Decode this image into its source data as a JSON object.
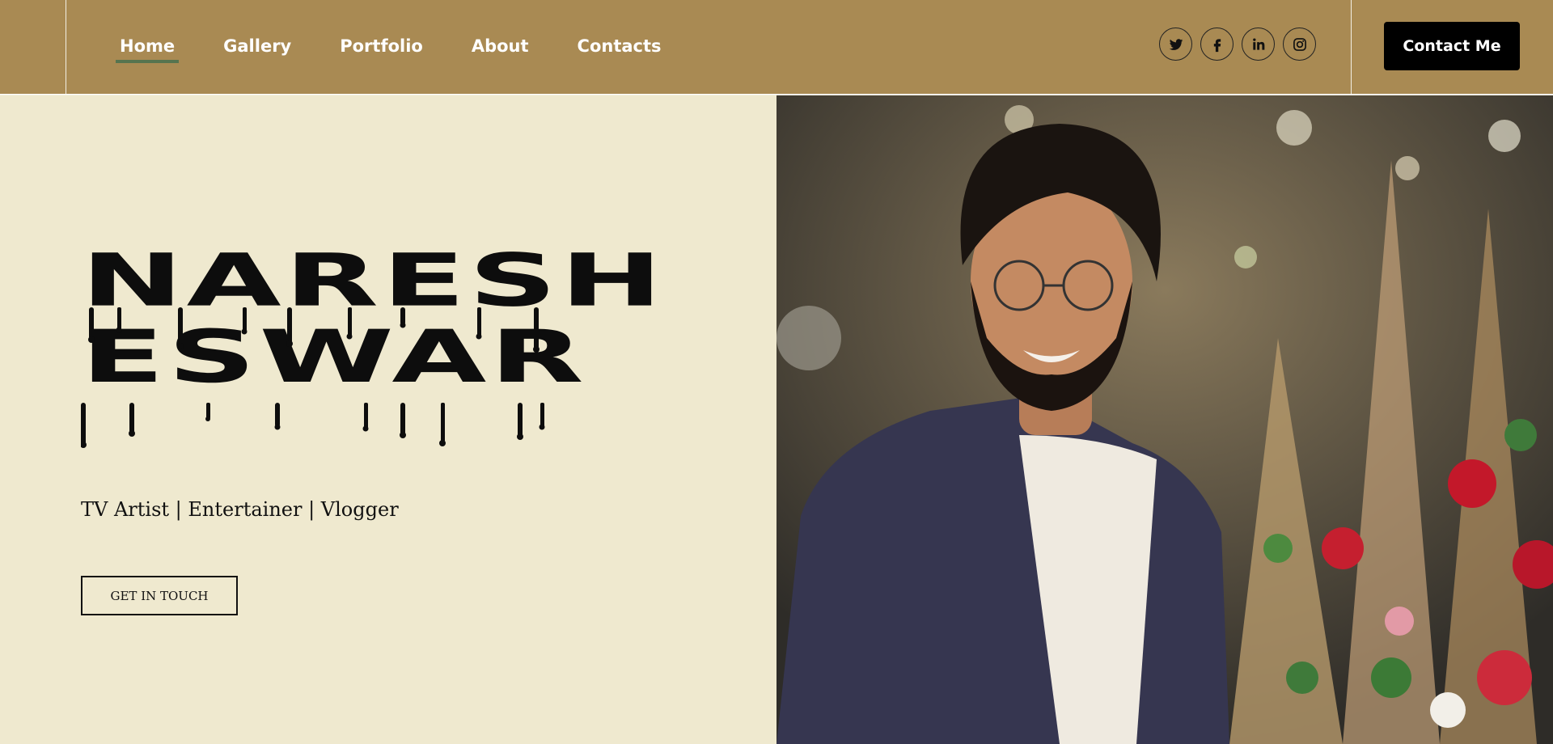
{
  "nav": {
    "items": [
      {
        "label": "Home",
        "active": true
      },
      {
        "label": "Gallery",
        "active": false
      },
      {
        "label": "Portfolio",
        "active": false
      },
      {
        "label": "About",
        "active": false
      },
      {
        "label": "Contacts",
        "active": false
      }
    ]
  },
  "socials": [
    {
      "icon": "twitter-icon"
    },
    {
      "icon": "facebook-icon"
    },
    {
      "icon": "linkedin-icon"
    },
    {
      "icon": "instagram-icon"
    }
  ],
  "header": {
    "contact_label": "Contact Me"
  },
  "hero": {
    "name_line1": "NARESH",
    "name_line2": "ESWAR",
    "tagline": "TV Artist | Entertainer | Vlogger",
    "cta_label": "GET IN TOUCH"
  },
  "colors": {
    "header_bg": "#a98a53",
    "hero_bg": "#efe9cf",
    "nav_active_underline": "#56744f",
    "button_dark": "#000000"
  }
}
